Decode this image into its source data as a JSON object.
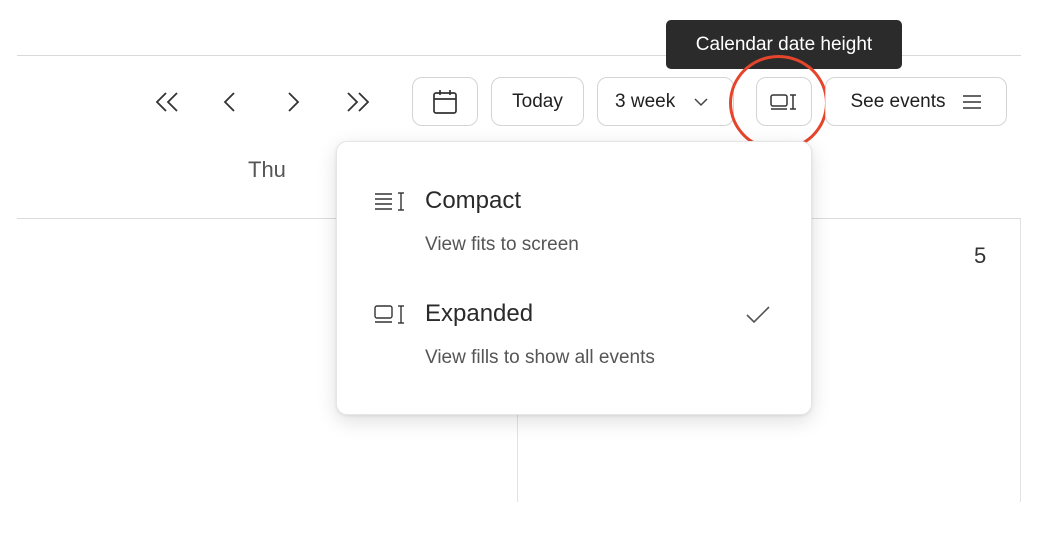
{
  "tooltip": {
    "text": "Calendar date height"
  },
  "toolbar": {
    "first_icon": "double-chevron-left-icon",
    "prev_icon": "chevron-left-icon",
    "next_icon": "chevron-right-icon",
    "last_icon": "double-chevron-right-icon",
    "date_picker_icon": "calendar-icon",
    "today_label": "Today",
    "range_label": "3 week",
    "range_icon": "chevron-down-icon",
    "height_icon": "expanded-height-icon",
    "see_events_label": "See events",
    "see_events_icon": "list-icon"
  },
  "calendar": {
    "day_header": "Thu",
    "date_number": "5"
  },
  "height_menu": {
    "items": [
      {
        "icon": "compact-height-icon",
        "title": "Compact",
        "description": "View fits to screen",
        "selected": false
      },
      {
        "icon": "expanded-height-icon",
        "title": "Expanded",
        "description": "View fills to show all events",
        "selected": true
      }
    ],
    "check_icon": "checkmark-icon"
  },
  "colors": {
    "highlight_ring": "#e5452b",
    "tooltip_bg": "#2b2b2b"
  }
}
